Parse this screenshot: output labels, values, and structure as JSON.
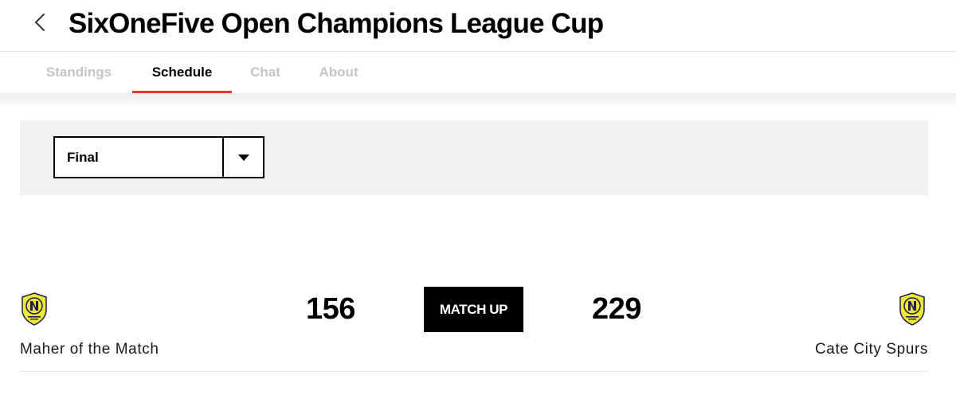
{
  "header": {
    "title": "SixOneFive Open Champions League Cup",
    "back_icon": "chevron-left-icon"
  },
  "tabs": [
    {
      "label": "Standings",
      "active": false
    },
    {
      "label": "Schedule",
      "active": true
    },
    {
      "label": "Chat",
      "active": false
    },
    {
      "label": "About",
      "active": false
    }
  ],
  "filter": {
    "round_selected": "Final",
    "caret_icon": "caret-down-icon"
  },
  "matchup": {
    "home": {
      "name": "Maher of the Match",
      "score": "156",
      "crest_icon": "nashville-sc-crest-icon"
    },
    "away": {
      "name": "Cate City Spurs",
      "score": "229",
      "crest_icon": "nashville-sc-crest-icon"
    },
    "button_label": "MATCH UP"
  },
  "colors": {
    "accent": "#e8392d",
    "inactive_tab": "#c4c4c4",
    "panel_bg": "#f1f1f1",
    "crest_yellow": "#ece83a",
    "crest_navy": "#1f1f4a"
  }
}
